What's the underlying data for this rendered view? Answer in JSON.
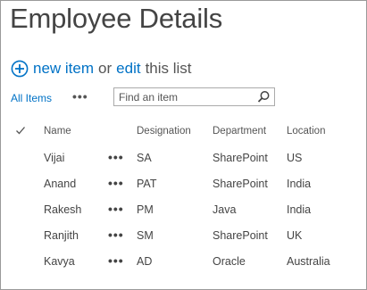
{
  "page": {
    "title": "Employee Details"
  },
  "new_item": {
    "new_label": "new item",
    "or_label": "or",
    "edit_label": "edit",
    "list_label": "this list"
  },
  "views": {
    "current": "All Items",
    "more": "•••"
  },
  "search": {
    "placeholder": "Find an item"
  },
  "table": {
    "columns": [
      "Name",
      "Designation",
      "Department",
      "Location"
    ],
    "row_menu": "•••",
    "rows": [
      {
        "name": "Vijai",
        "designation": "SA",
        "department": "SharePoint",
        "location": "US"
      },
      {
        "name": "Anand",
        "designation": "PAT",
        "department": "SharePoint",
        "location": "India"
      },
      {
        "name": "Rakesh",
        "designation": "PM",
        "department": "Java",
        "location": "India"
      },
      {
        "name": "Ranjith",
        "designation": "SM",
        "department": "SharePoint",
        "location": "UK"
      },
      {
        "name": "Kavya",
        "designation": "AD",
        "department": "Oracle",
        "location": "Australia"
      }
    ]
  },
  "colors": {
    "accent": "#0072c6",
    "text": "#444444",
    "border": "#ababab"
  },
  "icons": {
    "add": "plus-circle-icon",
    "search": "magnifier-icon",
    "select_all": "checkmark-icon"
  }
}
